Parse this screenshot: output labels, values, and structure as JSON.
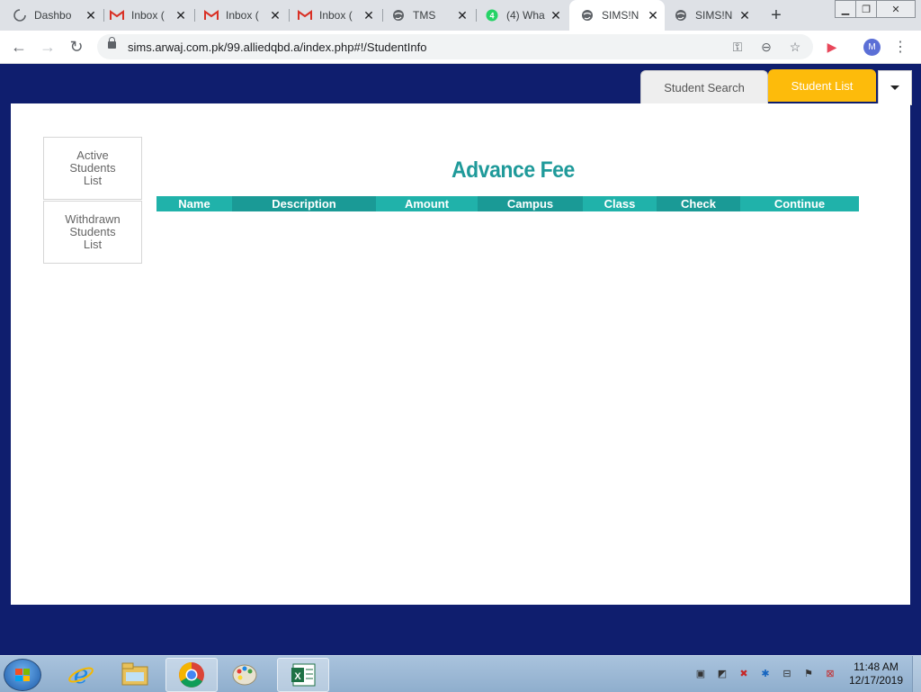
{
  "browser": {
    "tabs": [
      {
        "label": "Dashbo",
        "icon": "loading-spinner-icon"
      },
      {
        "label": "Inbox (",
        "icon": "gmail-icon"
      },
      {
        "label": "Inbox (",
        "icon": "gmail-icon"
      },
      {
        "label": "Inbox (",
        "icon": "gmail-icon"
      },
      {
        "label": "TMS",
        "icon": "globe-icon"
      },
      {
        "label": "(4) Wha",
        "icon": "whatsapp-icon"
      },
      {
        "label": "SIMS!N",
        "icon": "globe-icon"
      },
      {
        "label": "SIMS!N",
        "icon": "globe-icon"
      }
    ],
    "url": "sims.arwaj.com.pk/99.alliedqbd.a/index.php#!/StudentInfo",
    "profile_initial": "M"
  },
  "app": {
    "nav": {
      "student_search": "Student Search",
      "student_list": "Student List"
    },
    "sidebar": {
      "active": "Active Students List",
      "withdrawn": "Withdrawn Students List"
    },
    "heading": "Advance Fee",
    "columns": [
      "Name",
      "Description",
      "Amount",
      "Campus",
      "Class",
      "Check",
      "Continue"
    ]
  },
  "taskbar": {
    "time": "11:48 AM",
    "date": "12/17/2019"
  },
  "colors": {
    "page_bg": "#0f1e6e",
    "accent_teal": "#20b2aa",
    "tab_yellow": "#fdbb0b"
  }
}
